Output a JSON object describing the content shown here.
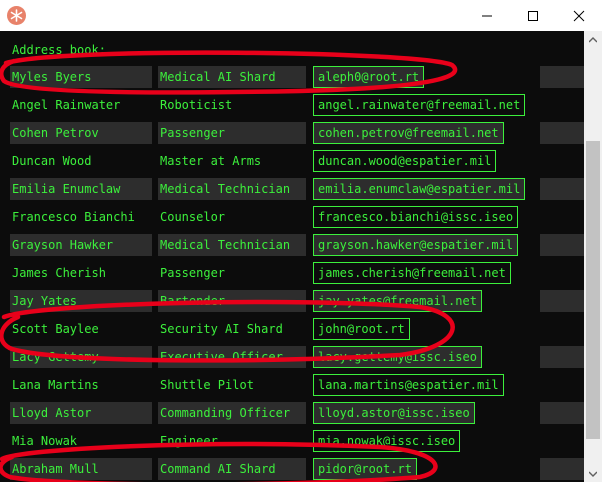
{
  "window": {
    "icon": "app-icon",
    "controls": [
      "minimize-icon",
      "maximize-icon",
      "close-icon"
    ]
  },
  "heading": "Address book:",
  "colors": {
    "text": "#3cf03c",
    "row_alt": "#2d2d2d",
    "annotation": "#e8001a"
  },
  "contacts": [
    {
      "name": "Myles Byers",
      "role": "Medical AI Shard",
      "email": "aleph0@root.rt"
    },
    {
      "name": "Angel Rainwater",
      "role": "Roboticist",
      "email": "angel.rainwater@freemail.net"
    },
    {
      "name": "Cohen Petrov",
      "role": "Passenger",
      "email": "cohen.petrov@freemail.net"
    },
    {
      "name": "Duncan Wood",
      "role": "Master at Arms",
      "email": "duncan.wood@espatier.mil"
    },
    {
      "name": "Emilia Enumclaw",
      "role": "Medical Technician",
      "email": "emilia.enumclaw@espatier.mil"
    },
    {
      "name": "Francesco Bianchi",
      "role": "Counselor",
      "email": "francesco.bianchi@issc.iseo"
    },
    {
      "name": "Grayson Hawker",
      "role": "Medical Technician",
      "email": "grayson.hawker@espatier.mil"
    },
    {
      "name": "James Cherish",
      "role": "Passenger",
      "email": "james.cherish@freemail.net"
    },
    {
      "name": "Jay Yates",
      "role": "Bartender",
      "email": "jay.yates@freemail.net"
    },
    {
      "name": "Scott Baylee",
      "role": "Security AI Shard",
      "email": "john@root.rt"
    },
    {
      "name": "Lacy Gettemy",
      "role": "Executive Officer",
      "email": "lacy.gettemy@issc.iseo"
    },
    {
      "name": "Lana Martins",
      "role": "Shuttle Pilot",
      "email": "lana.martins@espatier.mil"
    },
    {
      "name": "Lloyd Astor",
      "role": "Commanding Officer",
      "email": "lloyd.astor@issc.iseo"
    },
    {
      "name": "Mia Nowak",
      "role": "Engineer",
      "email": "mia.nowak@issc.iseo"
    },
    {
      "name": "Abraham Mull",
      "role": "Command AI Shard",
      "email": "pidor@root.rt"
    }
  ]
}
